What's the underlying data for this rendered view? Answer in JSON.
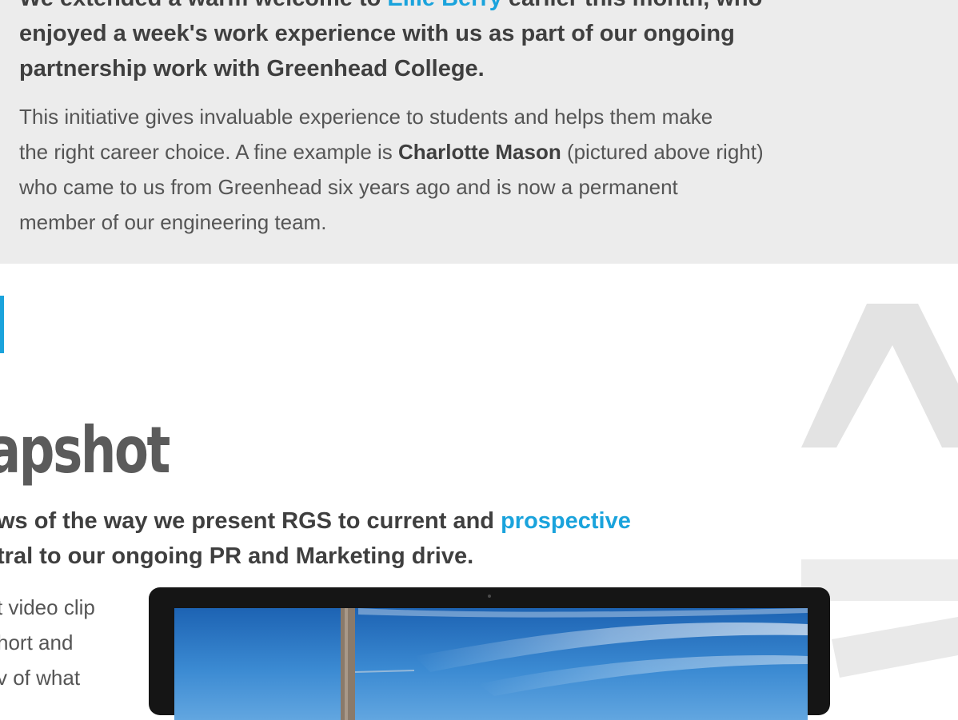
{
  "feature": {
    "lead": {
      "line1_start": "We extended a warm welcome to ",
      "name": "Ellie Berry",
      "line1_end": " earlier this month, who",
      "line2": "enjoyed a week's work experience with us as part of our ongoing",
      "line3": "partnership work with Greenhead College."
    },
    "body": {
      "line1": "This initiative gives invaluable experience to students and helps them make",
      "line2_start": "the right career choice. A fine example is ",
      "highlight_name": "Charlotte Mason",
      "line2_end": " (pictured above right)",
      "line3": "who came to us from Greenhead six years ago and is now a permanent",
      "line4": "member of our engineering team."
    }
  },
  "snapshot": {
    "heading": "apshot",
    "intro": {
      "line1_start": "ws of the way we present RGS to current and ",
      "line1_link": "prospective",
      "line2": "tral to our ongoing PR and Marketing drive."
    },
    "side_text": [
      "t video clip",
      "hort and",
      "v of what"
    ]
  },
  "colors": {
    "accent": "#1aa3dc",
    "panel": "#ececec",
    "heading": "#5b5b5b"
  }
}
